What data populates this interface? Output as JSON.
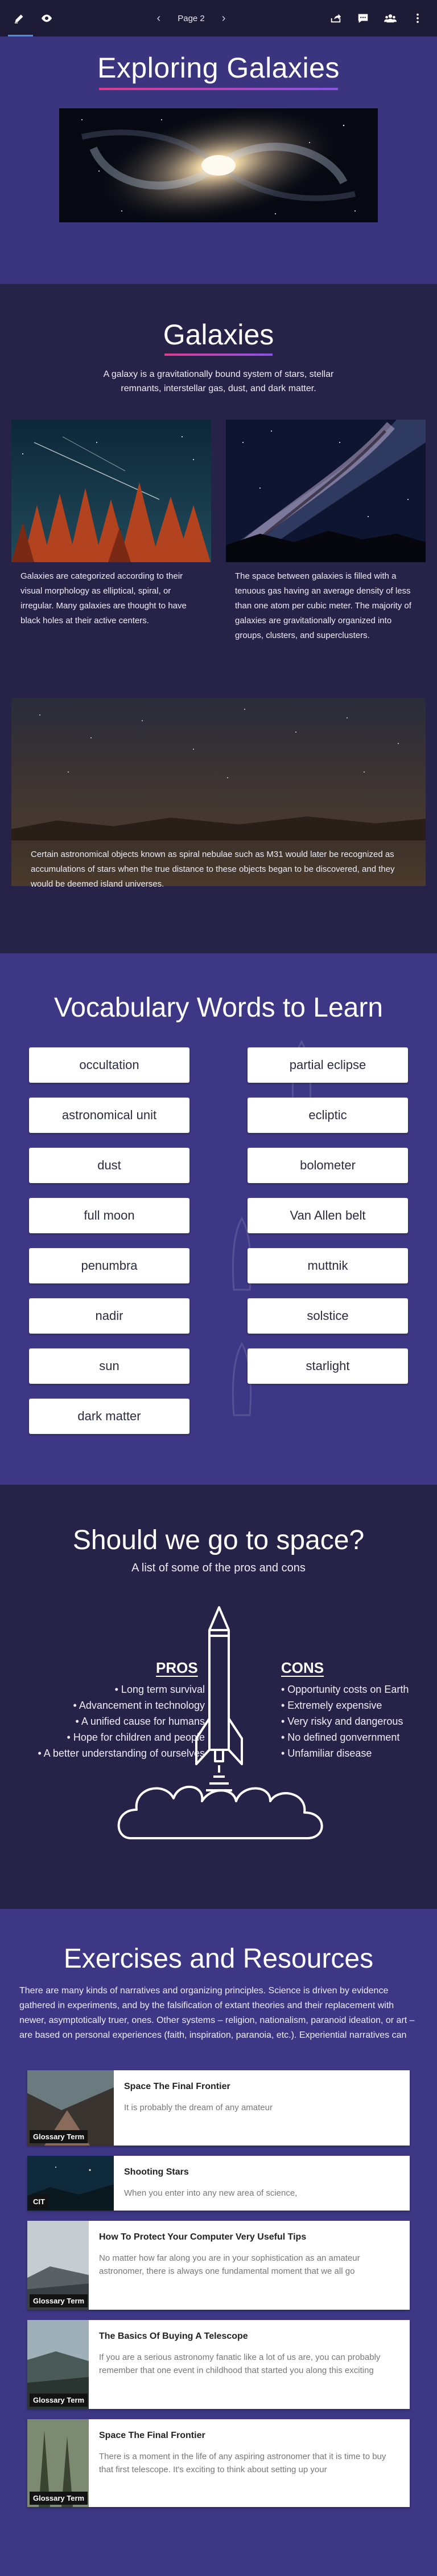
{
  "toolbar": {
    "page_label": "Page 2",
    "prev_arrow": "‹",
    "next_arrow": "›",
    "accent": "#4a90e2"
  },
  "hero": {
    "title": "Exploring Galaxies",
    "image_alt": "spiral galaxy"
  },
  "galaxies": {
    "title": "Galaxies",
    "intro": "A galaxy is a gravitationally bound system of stars, stellar remnants, interstellar gas, dust, and dark matter.",
    "left_text": "Galaxies are categorized according to their visual morphology as elliptical, spiral, or irregular. Many galaxies are thought to have black holes at their active centers.",
    "right_text": "The space between galaxies is filled with a tenuous gas having an average density of less than one atom per cubic meter. The majority of galaxies are gravitationally organized into groups, clusters, and superclusters.",
    "wide_text": "Certain astronomical objects known as spiral nebulae such as M31 would later be recognized as accumulations of stars when the true distance to these objects began to be discovered, and they would be deemed island universes."
  },
  "vocabulary": {
    "title": "Vocabulary Words to Learn",
    "words": [
      "occultation",
      "partial eclipse",
      "astronomical unit",
      "ecliptic",
      "dust",
      "bolometer",
      "full moon",
      "Van Allen belt",
      "penumbra",
      "muttnik",
      "nadir",
      "solstice",
      "sun",
      "starlight",
      "dark matter"
    ]
  },
  "space": {
    "title": "Should we go to space?",
    "subtitle": "A list of some of the pros and cons",
    "pros_title": "PROS",
    "cons_title": "CONS",
    "pros": [
      "• Long term survival",
      "• Advancement in technology",
      "• A unified cause for humans",
      "• Hope for children and people",
      "• A better understanding of ourselves"
    ],
    "cons": [
      "• Opportunity costs on Earth",
      "• Extremely expensive",
      "• Very risky and dangerous",
      "• No defined gonvernment",
      "• Unfamiliar disease"
    ]
  },
  "exercises": {
    "title": "Exercises and Resources",
    "intro": "There are many kinds of narratives and organizing principles. Science is driven by evidence gathered in experiments, and by the falsification of extant theories and their replacement with newer, asymptotically truer, ones. Other systems – religion, nationalism, paranoid ideation, or art – are based on personal experiences (faith, inspiration, paranoia, etc.). Experiential narratives can and do interact with evidential narratives and vice versa. For instance: belief in God inspires some",
    "cards": [
      {
        "tag": "Glossary Term",
        "title": "Space The Final Frontier",
        "text": "It is probably the dream of any amateur"
      },
      {
        "tag": "CIT",
        "title": "Shooting Stars",
        "text": "When you enter into any new area of science,"
      },
      {
        "tag": "Glossary Term",
        "title": "How To Protect Your Computer Very Useful Tips",
        "text": "No matter how far along you are in your sophistication as an amateur astronomer, there is always one fundamental moment that we all go"
      },
      {
        "tag": "Glossary Term",
        "title": "The Basics Of Buying A Telescope",
        "text": "If you are a serious astronomy fanatic like a lot of us are, you can probably remember that one event in childhood that started you along this exciting"
      },
      {
        "tag": "Glossary Term",
        "title": "Space The Final Frontier",
        "text": "There is a moment in the life of any aspiring astronomer that it is time to buy that first telescope. It's exciting to think about setting up your"
      }
    ]
  }
}
